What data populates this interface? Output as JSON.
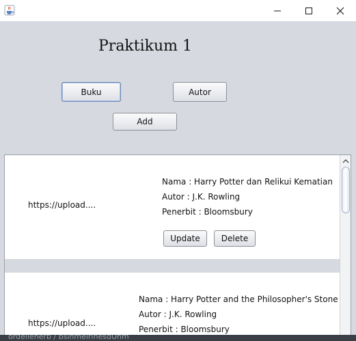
{
  "window": {
    "app_icon": "java-cup-icon",
    "controls": [
      "minimize-icon",
      "maximize-icon",
      "close-icon"
    ]
  },
  "main": {
    "title": "Praktikum 1",
    "buttons": {
      "buku": "Buku",
      "autor": "Autor",
      "add": "Add"
    }
  },
  "books": [
    {
      "image_url": "https://upload....",
      "nama": "Nama : Harry Potter dan Relikui Kematian",
      "autor": "Autor : J.K. Rowling",
      "penerbit": "Penerbit : Bloomsbury",
      "update_label": "Update",
      "delete_label": "Delete"
    },
    {
      "image_url": "https://upload....",
      "nama": "Nama : Harry Potter and the Philosopher's Stone",
      "autor": "Autor : J.K. Rowling",
      "penerbit": "Penerbit : Bloomsbury"
    }
  ],
  "taskbar_snippet": "ordellenerb / bsinmelrinesdUnm"
}
